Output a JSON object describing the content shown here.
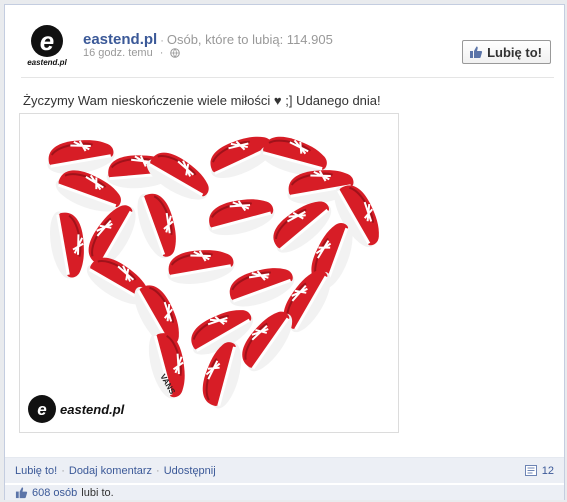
{
  "page": {
    "name": "eastend.pl",
    "likes_label": "Osób, które to lubią: 114.905",
    "timestamp": "16 godz. temu",
    "like_button": "Lubię to!",
    "logo_text": "eastend.pl",
    "logo_letter": "e"
  },
  "post": {
    "message": "Życzymy Wam nieskończenie wiele miłości ♥ ;] Udanego dnia!",
    "photo_watermark": "eastend.pl",
    "shoe_brand": "VANS"
  },
  "actions": {
    "like": "Lubię to!",
    "comment": "Dodaj komentarz",
    "share": "Udostępnij",
    "comment_count": "12"
  },
  "likes": {
    "count_link": "608 osób",
    "suffix": "lubi to."
  },
  "colors": {
    "shoe_red": "#d71d26",
    "link_blue": "#3b5998",
    "footer_bg": "#eceff5"
  },
  "icons": [
    "globe-icon",
    "thumbs-up-icon",
    "comment-icon"
  ]
}
